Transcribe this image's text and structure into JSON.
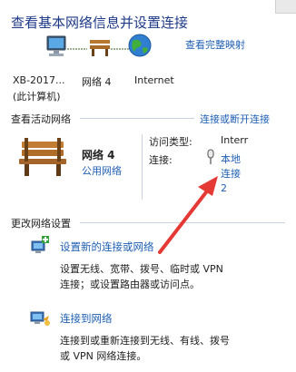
{
  "header": {
    "title": "查看基本网络信息并设置连接",
    "full_map_link": "查看完整映射"
  },
  "map": {
    "computer_name": "XB-2017...",
    "computer_sub": "(此计算机)",
    "network_name": "网络  4",
    "internet_label": "Internet"
  },
  "active": {
    "section_label": "查看活动网络",
    "connect_link": "连接或断开连接",
    "network_name": "网络  4",
    "network_type": "公用网络",
    "access_type_label": "访问类型:",
    "access_type_value": "Interr",
    "connection_label": "连接:",
    "connection_value_lines": [
      "本地",
      "连接",
      "2"
    ]
  },
  "change": {
    "section_label": "更改网络设置",
    "items": [
      {
        "title": "设置新的连接或网络",
        "desc_lines": [
          "设置无线、宽带、拨号、临时或 VPN",
          "连接；或设置路由器或访问点。"
        ]
      },
      {
        "title": "连接到网络",
        "desc_lines": [
          "连接到或重新连接到无线、有线、拨号",
          "或 VPN 网络连接。"
        ]
      }
    ]
  },
  "colors": {
    "link": "#1e5fb4",
    "title": "#1e3a8a",
    "arrow": "#e53935"
  },
  "icons": {
    "computer": "computer-icon",
    "bench": "bench-icon",
    "globe": "globe-icon",
    "connection": "wired-connection-icon",
    "setup": "network-setup-icon",
    "connect": "connect-network-icon"
  }
}
